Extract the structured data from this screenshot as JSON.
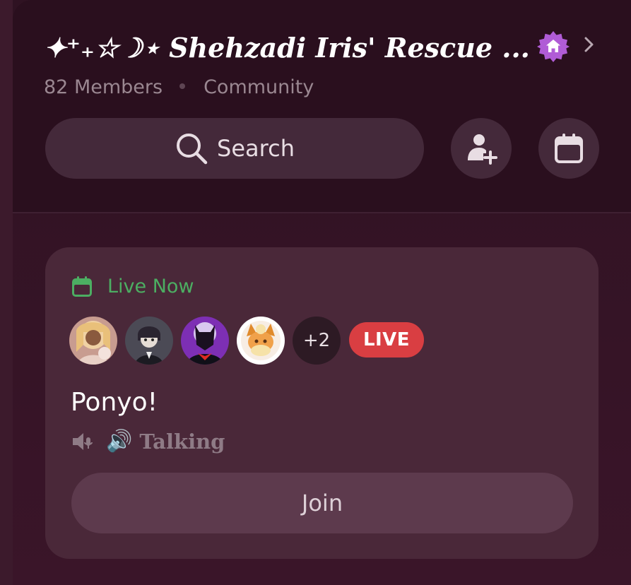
{
  "server": {
    "title": "✦⁺₊☆☽⋆ Shehzadi Iris' Rescue ...",
    "members": "82 Members",
    "category": "Community",
    "badge_icon": "home-icon",
    "badge_color": "#b05cd6"
  },
  "actions": {
    "search_label": "Search",
    "invite_icon": "add-user-icon",
    "events_icon": "calendar-icon"
  },
  "event": {
    "status_label": "Live Now",
    "status_color": "#4cae62",
    "attendees": [
      {
        "avatar": "avatar-1"
      },
      {
        "avatar": "avatar-2"
      },
      {
        "avatar": "avatar-3"
      },
      {
        "avatar": "avatar-4"
      }
    ],
    "more_count": "+2",
    "live_badge": "LIVE",
    "live_color": "#d93e42",
    "title": "Ponyo!",
    "channel": "Talking",
    "join_label": "Join"
  }
}
